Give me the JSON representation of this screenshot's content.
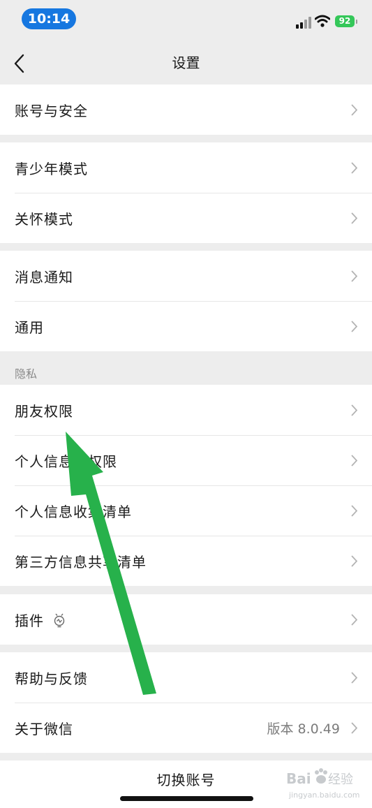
{
  "status": {
    "time": "10:14",
    "battery": "92"
  },
  "nav": {
    "title": "设置"
  },
  "groups": {
    "account": [
      "账号与安全"
    ],
    "youth": [
      "青少年模式",
      "关怀模式"
    ],
    "notify": [
      "消息通知",
      "通用"
    ],
    "privacy_header": "隐私",
    "privacy": [
      "朋友权限",
      "个人信息与权限",
      "个人信息收集清单",
      "第三方信息共享清单"
    ],
    "plugins": [
      "插件"
    ],
    "help": [
      "帮助与反馈",
      "关于微信"
    ]
  },
  "about_version": "版本 8.0.49",
  "switch_account": "切换账号",
  "watermark": {
    "logo": "Bai百度经验",
    "url": "jingyan.baidu.com"
  },
  "colors": {
    "accent_arrow": "#27b14b",
    "time_pill": "#1677e0",
    "battery": "#34c759"
  }
}
